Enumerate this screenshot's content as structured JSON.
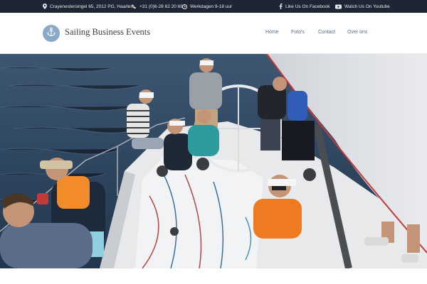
{
  "topbar": {
    "address": "Crayenestersingel 65, 2012 PG, Haarlem",
    "phone": "+31 (0)6-28 62 20 69",
    "hours": "Werkdagen 9-18 uur",
    "facebook": "Like Us On Facebook",
    "youtube": "Watch Us On Youtube",
    "icons": [
      "map-pin-icon",
      "phone-icon",
      "clock-icon",
      "facebook-icon",
      "youtube-icon"
    ]
  },
  "header": {
    "brand": "Sailing Business Events",
    "logo_icon": "anchor-icon",
    "nav": [
      "Home",
      "Foto's",
      "Contact",
      "Over ons"
    ]
  },
  "hero": {
    "image": "sailing-yacht-crew-photo"
  },
  "colors": {
    "topbar_bg": "#1f2533",
    "logo_bg": "#8aa9c9",
    "nav_text": "#5b6f85",
    "brand_text": "#3b3f47"
  }
}
